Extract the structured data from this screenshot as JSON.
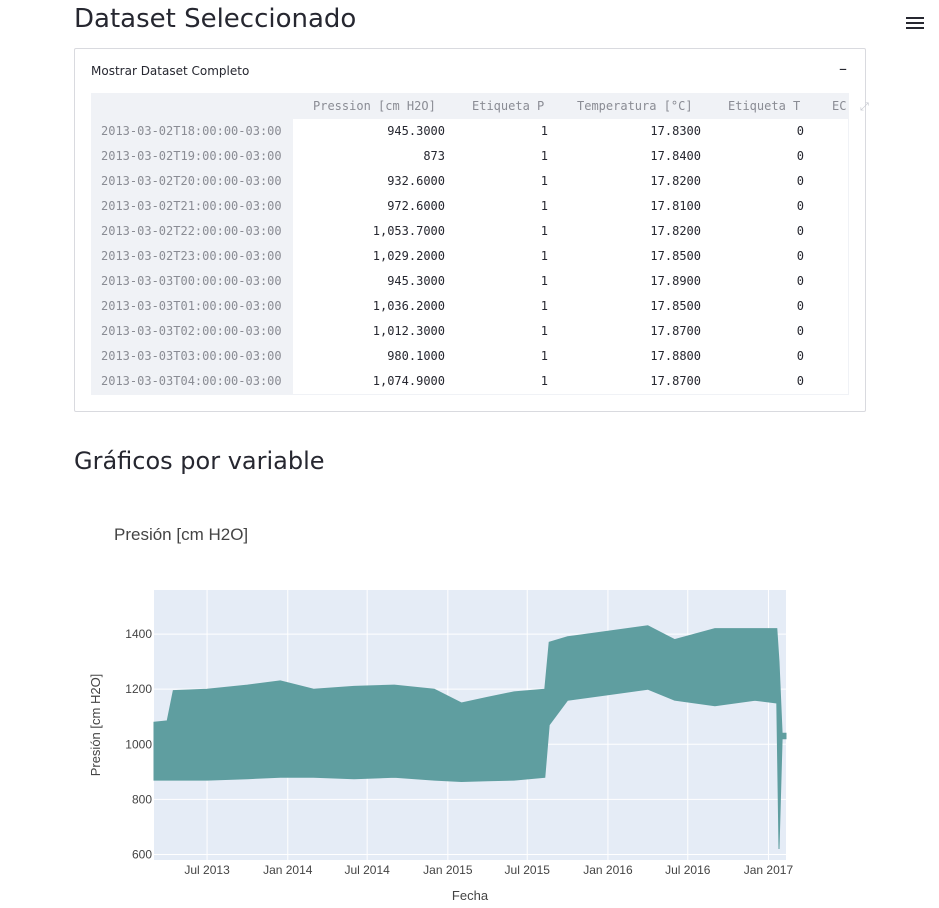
{
  "page": {
    "title": "Dataset Seleccionado",
    "section_title": "Gráficos por variable",
    "menu_icon": "hamburger-menu-icon"
  },
  "expander": {
    "label": "Mostrar Dataset Completo",
    "toggle_symbol": "–"
  },
  "table": {
    "columns": [
      "Pression [cm H2O]",
      "Etiqueta P",
      "Temperatura [°C]",
      "Etiqueta T",
      "EC"
    ],
    "rows": [
      {
        "index": "2013-03-02T18:00:00-03:00",
        "values": [
          "945.3000",
          "1",
          "17.8300",
          "0"
        ]
      },
      {
        "index": "2013-03-02T19:00:00-03:00",
        "values": [
          "873",
          "1",
          "17.8400",
          "0"
        ]
      },
      {
        "index": "2013-03-02T20:00:00-03:00",
        "values": [
          "932.6000",
          "1",
          "17.8200",
          "0"
        ]
      },
      {
        "index": "2013-03-02T21:00:00-03:00",
        "values": [
          "972.6000",
          "1",
          "17.8100",
          "0"
        ]
      },
      {
        "index": "2013-03-02T22:00:00-03:00",
        "values": [
          "1,053.7000",
          "1",
          "17.8200",
          "0"
        ]
      },
      {
        "index": "2013-03-02T23:00:00-03:00",
        "values": [
          "1,029.2000",
          "1",
          "17.8500",
          "0"
        ]
      },
      {
        "index": "2013-03-03T00:00:00-03:00",
        "values": [
          "945.3000",
          "1",
          "17.8900",
          "0"
        ]
      },
      {
        "index": "2013-03-03T01:00:00-03:00",
        "values": [
          "1,036.2000",
          "1",
          "17.8500",
          "0"
        ]
      },
      {
        "index": "2013-03-03T02:00:00-03:00",
        "values": [
          "1,012.3000",
          "1",
          "17.8700",
          "0"
        ]
      },
      {
        "index": "2013-03-03T03:00:00-03:00",
        "values": [
          "980.1000",
          "1",
          "17.8800",
          "0"
        ]
      },
      {
        "index": "2013-03-03T04:00:00-03:00",
        "values": [
          "1,074.9000",
          "1",
          "17.8700",
          "0"
        ]
      }
    ]
  },
  "chart_data": {
    "type": "area",
    "title": "Presión [cm H2O]",
    "xlabel": "Fecha",
    "ylabel": "Presión [cm H2O]",
    "x_ticks": [
      "Jul 2013",
      "Jan 2014",
      "Jul 2014",
      "Jan 2015",
      "Jul 2015",
      "Jan 2016",
      "Jul 2016",
      "Jan 2017"
    ],
    "y_ticks": [
      600,
      800,
      1000,
      1200,
      1400
    ],
    "ylim": [
      580,
      1560
    ],
    "xlim": [
      "2013-03-02",
      "2017-02-10"
    ],
    "grid": true,
    "color": "#5f9ea0",
    "background": "#e5ecf6",
    "series": [
      {
        "band": [
          {
            "x": "2013-03-02",
            "low": 870,
            "high": 1080
          },
          {
            "x": "2013-04-01",
            "low": 870,
            "high": 1085
          },
          {
            "x": "2013-04-15",
            "low": 870,
            "high": 1195
          },
          {
            "x": "2013-07-01",
            "low": 870,
            "high": 1200
          },
          {
            "x": "2013-10-01",
            "low": 875,
            "high": 1215
          },
          {
            "x": "2013-12-15",
            "low": 880,
            "high": 1230
          },
          {
            "x": "2014-03-01",
            "low": 880,
            "high": 1200
          },
          {
            "x": "2014-06-01",
            "low": 875,
            "high": 1210
          },
          {
            "x": "2014-09-01",
            "low": 880,
            "high": 1215
          },
          {
            "x": "2014-12-01",
            "low": 870,
            "high": 1200
          },
          {
            "x": "2015-02-01",
            "low": 865,
            "high": 1150
          },
          {
            "x": "2015-04-01",
            "low": 868,
            "high": 1170
          },
          {
            "x": "2015-06-01",
            "low": 870,
            "high": 1190
          },
          {
            "x": "2015-08-10",
            "low": 880,
            "high": 1200
          },
          {
            "x": "2015-08-20",
            "low": 1070,
            "high": 1370
          },
          {
            "x": "2015-10-01",
            "low": 1160,
            "high": 1390
          },
          {
            "x": "2016-01-01",
            "low": 1180,
            "high": 1410
          },
          {
            "x": "2016-04-01",
            "low": 1200,
            "high": 1430
          },
          {
            "x": "2016-06-01",
            "low": 1160,
            "high": 1380
          },
          {
            "x": "2016-09-01",
            "low": 1140,
            "high": 1420
          },
          {
            "x": "2016-12-01",
            "low": 1160,
            "high": 1420
          },
          {
            "x": "2017-01-20",
            "low": 1150,
            "high": 1420
          },
          {
            "x": "2017-01-25",
            "low": 620,
            "high": 1300
          },
          {
            "x": "2017-02-01",
            "low": 1020,
            "high": 1040
          },
          {
            "x": "2017-02-10",
            "low": 1020,
            "high": 1040
          }
        ]
      }
    ]
  }
}
